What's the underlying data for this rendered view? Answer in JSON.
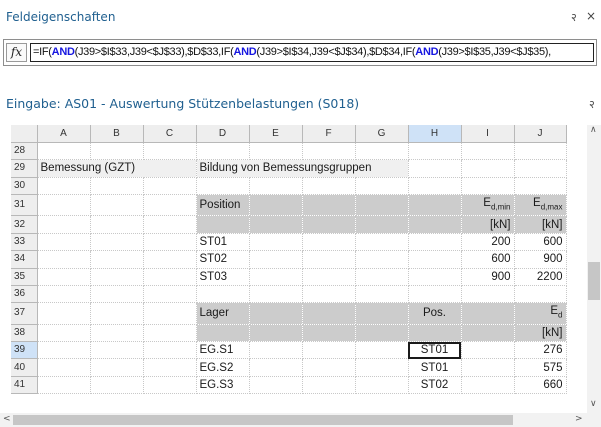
{
  "properties_pane": {
    "title": "Feldeigenschaften",
    "pin_icon": "२",
    "close_icon": "×",
    "fx_label": "fx",
    "formula_parts": [
      {
        "text": "=IF(",
        "kw": false
      },
      {
        "text": "AND",
        "kw": true
      },
      {
        "text": "(J39>$I$33,J39<$J$33),$D$33,IF(",
        "kw": false
      },
      {
        "text": "AND",
        "kw": true
      },
      {
        "text": "(J39>$I$34,J39<$J$34),$D$34,IF(",
        "kw": false
      },
      {
        "text": "AND",
        "kw": true
      },
      {
        "text": "(J39>$I$35,J39<$J$35),",
        "kw": false
      }
    ]
  },
  "input_pane": {
    "title": "Eingabe: AS01 - Auswertung Stützenbelastungen (S018)",
    "pin_icon": "२"
  },
  "sheet": {
    "columns": [
      "A",
      "B",
      "C",
      "D",
      "E",
      "F",
      "G",
      "H",
      "I",
      "J"
    ],
    "selected_column": "H",
    "selected_row": "39",
    "rows": [
      {
        "n": "28",
        "cells": []
      },
      {
        "n": "29",
        "cells": [
          {
            "col": 0,
            "span": 3,
            "text": "Bemessung (GZT)",
            "cls": "lt"
          },
          {
            "col": 3,
            "span": 4,
            "text": "Bildung von Bemessungsgruppen",
            "cls": "lt"
          }
        ]
      },
      {
        "n": "30",
        "cells": []
      },
      {
        "n": "31",
        "cells": [
          {
            "col": 3,
            "span": 1,
            "text": "Position",
            "cls": "hl"
          },
          {
            "col": 4,
            "span": 1,
            "text": "",
            "cls": "hl"
          },
          {
            "col": 5,
            "span": 1,
            "text": "",
            "cls": "hl"
          },
          {
            "col": 6,
            "span": 1,
            "text": "",
            "cls": "hl"
          },
          {
            "col": 7,
            "span": 1,
            "text": "",
            "cls": "hl"
          },
          {
            "col": 8,
            "span": 1,
            "text": "E",
            "sub": "d,min",
            "cls": "hl r"
          },
          {
            "col": 9,
            "span": 1,
            "text": "E",
            "sub": "d,max",
            "cls": "hl r"
          }
        ]
      },
      {
        "n": "32",
        "cells": [
          {
            "col": 3,
            "span": 1,
            "text": "",
            "cls": "hl"
          },
          {
            "col": 4,
            "span": 1,
            "text": "",
            "cls": "hl"
          },
          {
            "col": 5,
            "span": 1,
            "text": "",
            "cls": "hl"
          },
          {
            "col": 6,
            "span": 1,
            "text": "",
            "cls": "hl"
          },
          {
            "col": 7,
            "span": 1,
            "text": "",
            "cls": "hl"
          },
          {
            "col": 8,
            "span": 1,
            "text": "[kN]",
            "cls": "hl r"
          },
          {
            "col": 9,
            "span": 1,
            "text": "[kN]",
            "cls": "hl r"
          }
        ]
      },
      {
        "n": "33",
        "cells": [
          {
            "col": 3,
            "span": 1,
            "text": "ST01",
            "cls": ""
          },
          {
            "col": 8,
            "span": 1,
            "text": "200",
            "cls": "r"
          },
          {
            "col": 9,
            "span": 1,
            "text": "600",
            "cls": "r"
          }
        ]
      },
      {
        "n": "34",
        "cells": [
          {
            "col": 3,
            "span": 1,
            "text": "ST02",
            "cls": ""
          },
          {
            "col": 8,
            "span": 1,
            "text": "600",
            "cls": "r"
          },
          {
            "col": 9,
            "span": 1,
            "text": "900",
            "cls": "r"
          }
        ]
      },
      {
        "n": "35",
        "cells": [
          {
            "col": 3,
            "span": 1,
            "text": "ST03",
            "cls": ""
          },
          {
            "col": 8,
            "span": 1,
            "text": "900",
            "cls": "r"
          },
          {
            "col": 9,
            "span": 1,
            "text": "2200",
            "cls": "r"
          }
        ]
      },
      {
        "n": "36",
        "cells": []
      },
      {
        "n": "37",
        "cells": [
          {
            "col": 3,
            "span": 1,
            "text": "Lager",
            "cls": "hl"
          },
          {
            "col": 4,
            "span": 1,
            "text": "",
            "cls": "hl"
          },
          {
            "col": 5,
            "span": 1,
            "text": "",
            "cls": "hl"
          },
          {
            "col": 6,
            "span": 1,
            "text": "",
            "cls": "hl"
          },
          {
            "col": 7,
            "span": 1,
            "text": "Pos.",
            "cls": "hl c"
          },
          {
            "col": 8,
            "span": 1,
            "text": "",
            "cls": "hl"
          },
          {
            "col": 9,
            "span": 1,
            "text": "E",
            "sub": "d",
            "cls": "hl r"
          }
        ]
      },
      {
        "n": "38",
        "cells": [
          {
            "col": 3,
            "span": 1,
            "text": "",
            "cls": "hl"
          },
          {
            "col": 4,
            "span": 1,
            "text": "",
            "cls": "hl"
          },
          {
            "col": 5,
            "span": 1,
            "text": "",
            "cls": "hl"
          },
          {
            "col": 6,
            "span": 1,
            "text": "",
            "cls": "hl"
          },
          {
            "col": 7,
            "span": 1,
            "text": "",
            "cls": "hl"
          },
          {
            "col": 8,
            "span": 1,
            "text": "",
            "cls": "hl"
          },
          {
            "col": 9,
            "span": 1,
            "text": "[kN]",
            "cls": "hl r"
          }
        ]
      },
      {
        "n": "39",
        "cells": [
          {
            "col": 3,
            "span": 1,
            "text": "EG.S1",
            "cls": ""
          },
          {
            "col": 7,
            "span": 1,
            "text": "ST01",
            "cls": "c active"
          },
          {
            "col": 9,
            "span": 1,
            "text": "276",
            "cls": "r"
          }
        ]
      },
      {
        "n": "40",
        "cells": [
          {
            "col": 3,
            "span": 1,
            "text": "EG.S2",
            "cls": ""
          },
          {
            "col": 7,
            "span": 1,
            "text": "ST01",
            "cls": "c"
          },
          {
            "col": 9,
            "span": 1,
            "text": "575",
            "cls": "r"
          }
        ]
      },
      {
        "n": "41",
        "cells": [
          {
            "col": 3,
            "span": 1,
            "text": "EG.S3",
            "cls": ""
          },
          {
            "col": 7,
            "span": 1,
            "text": "ST02",
            "cls": "c"
          },
          {
            "col": 9,
            "span": 1,
            "text": "660",
            "cls": "r"
          }
        ]
      }
    ]
  },
  "scrollbars": {
    "up_arrow": "∧",
    "down_arrow": "∨",
    "left_arrow": "<",
    "right_arrow": ">"
  }
}
